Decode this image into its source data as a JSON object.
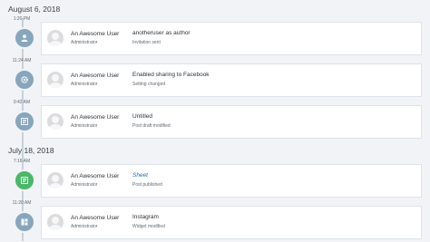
{
  "groups": [
    {
      "date": "August 6, 2018",
      "entries": [
        {
          "time": "1:20 PM",
          "icon": "user-icon",
          "user": "An Awesome User",
          "role": "Administrator",
          "action": "anotheruser as author",
          "status": "Invitation sent"
        },
        {
          "time": "11:24 AM",
          "icon": "gear-icon",
          "user": "An Awesome User",
          "role": "Administrator",
          "action": "Enabled sharing to Facebook",
          "status": "Setting changed"
        },
        {
          "time": "9:42 AM",
          "icon": "post-icon",
          "user": "An Awesome User",
          "role": "Administrator",
          "action": "Untitled",
          "status": "Post draft modified"
        }
      ]
    },
    {
      "date": "July 18, 2018",
      "entries": [
        {
          "time": "7:16 AM",
          "icon": "post-icon",
          "user": "An Awesome User",
          "role": "Administrator",
          "action": "Sheet",
          "status": "Post published"
        },
        {
          "time": "11:20 AM",
          "icon": "widget-icon",
          "user": "An Awesome User",
          "role": "Administrator",
          "action": "Instagram",
          "status": "Widget modified"
        }
      ]
    }
  ],
  "colors": {
    "node_default": "#87a6bc",
    "node_published": "#4ab866",
    "link": "#2271b1"
  }
}
